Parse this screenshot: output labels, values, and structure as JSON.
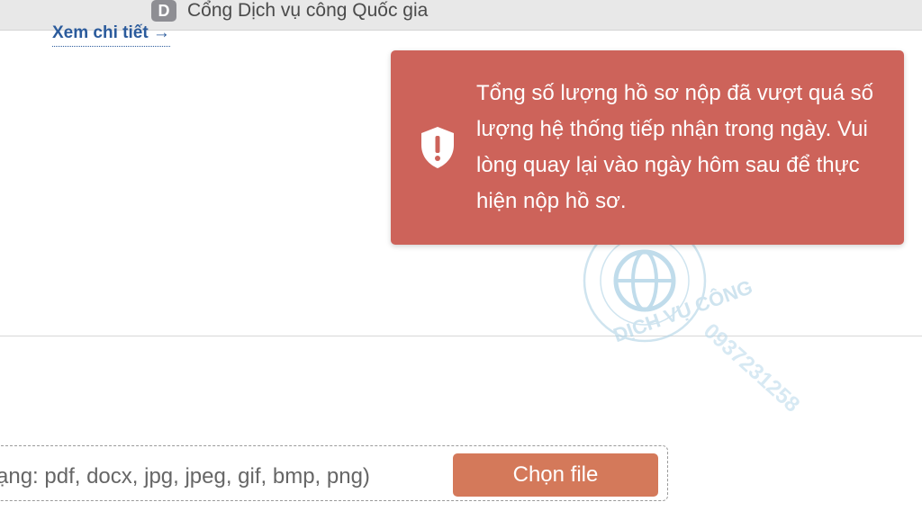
{
  "browser": {
    "tab": {
      "favicon_letter": "D",
      "title": "Cổng Dịch vụ công Quốc gia"
    }
  },
  "page": {
    "details_link": "Xem chi tiết →",
    "upload": {
      "hint": "ạng: pdf, docx, jpg, jpeg, gif, bmp, png)",
      "choose_button": "Chọn file"
    }
  },
  "toast": {
    "icon": "shield-exclamation-icon",
    "message": "Tổng số lượng hồ sơ nộp đã vượt quá số lượng hệ thống tiếp nhận trong ngày. Vui lòng quay lại vào ngày hôm sau để thực hiện nộp hồ sơ.",
    "color": "#cd635a"
  },
  "watermark": {
    "ring_text": "DỊCH VỤ CÔNG",
    "phone": "0937231258"
  },
  "colors": {
    "link": "#2b5b9c",
    "button": "#d4795a",
    "tabbar": "#e8e8e8"
  }
}
